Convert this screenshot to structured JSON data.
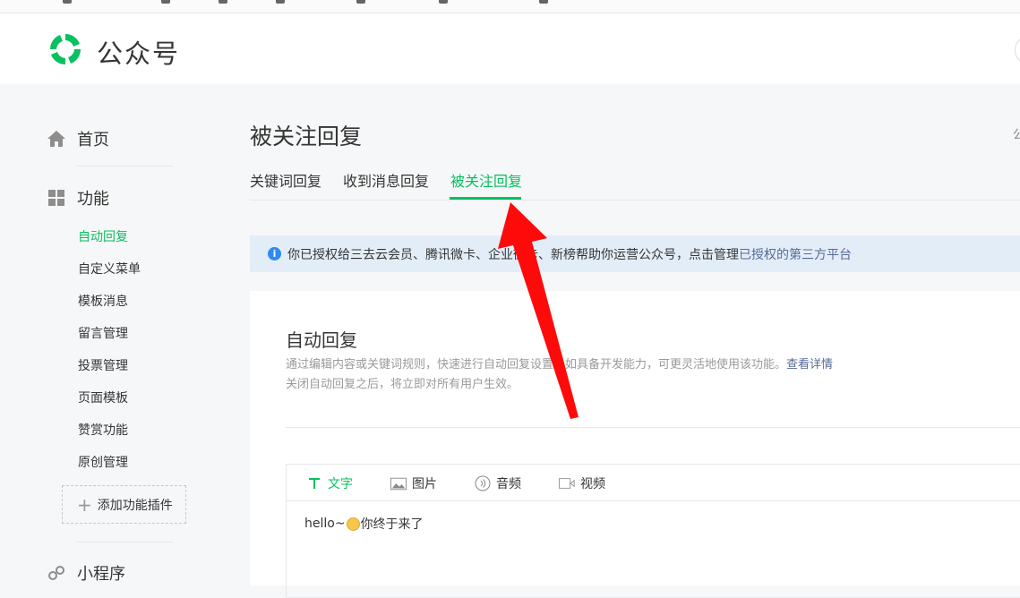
{
  "header": {
    "brand": "公众号"
  },
  "sidebar": {
    "home": "首页",
    "features": "功能",
    "sub_items": [
      "自动回复",
      "自定义菜单",
      "模板消息",
      "留言管理",
      "投票管理",
      "页面模板",
      "赞赏功能",
      "原创管理"
    ],
    "add_plugin": "添加功能插件",
    "mini_program": "小程序"
  },
  "main": {
    "title": "被关注回复",
    "side_cut_text": "公",
    "tabs": [
      "关键词回复",
      "收到消息回复",
      "被关注回复"
    ],
    "notice": {
      "text": "你已授权给三去云会员、腾讯微卡、企业微卡、新榜帮助你运营公众号，点击管理",
      "link": "已授权的第三方平台"
    },
    "card": {
      "title": "自动回复",
      "desc1": "通过编辑内容或关键词规则，快速进行自动回复设置。如具备开发能力，可更灵活地使用该功能。",
      "desc1_link": "查看详情",
      "desc2": "关闭自动回复之后，将立即对所有用户生效。",
      "tools": [
        "文字",
        "图片",
        "音频",
        "视频"
      ],
      "content_before": "hello~",
      "content_after": "你终于来了"
    }
  },
  "colors": {
    "accent": "#07c160",
    "link": "#576b95",
    "notice_bg": "#e3edf8",
    "arrow": "#ff0a0a"
  },
  "icons": [
    "wechat-logo-icon",
    "home-icon",
    "grid-icon",
    "plus-icon",
    "link-icon",
    "info-icon",
    "text-icon",
    "image-icon",
    "audio-icon",
    "video-icon",
    "smile-emoji-icon",
    "red-arrow-annotation"
  ]
}
